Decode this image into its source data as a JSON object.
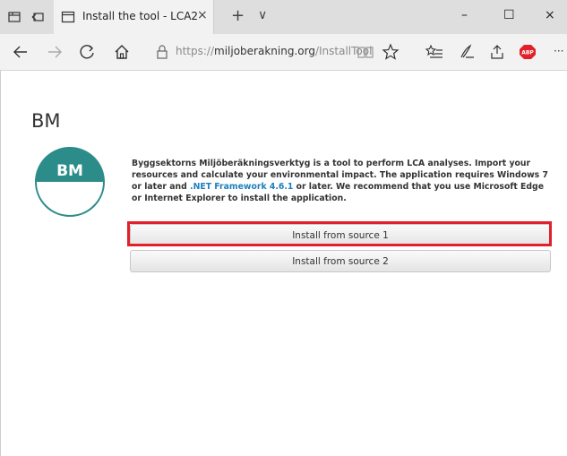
{
  "browser": {
    "tab_title": "Install the tool - LCA2",
    "tab_close": "×",
    "new_tab": "+",
    "tab_menu": "∨",
    "url_prefix": "https://",
    "url_domain": "miljoberakning.org",
    "url_path": "/InstallTool",
    "win_minimize": "–",
    "win_maximize": "☐",
    "win_close": "×",
    "more": "···"
  },
  "page": {
    "title": "BM",
    "logo_text": "BM",
    "desc_part1": "Byggsektorns Miljöberäkningsverktyg is a tool to perform LCA analyses. Import your resources and calculate your environmental impact. The application requires Windows 7 or later and ",
    "desc_link": ".NET Framework 4.6.1",
    "desc_part2": " or later. We recommend that you use Microsoft Edge or Internet Explorer to install the application.",
    "install1": "Install from source 1",
    "install2": "Install from source 2"
  },
  "colors": {
    "teal": "#2c8c8a",
    "highlight": "#e0202a",
    "link": "#1f7fbf"
  }
}
